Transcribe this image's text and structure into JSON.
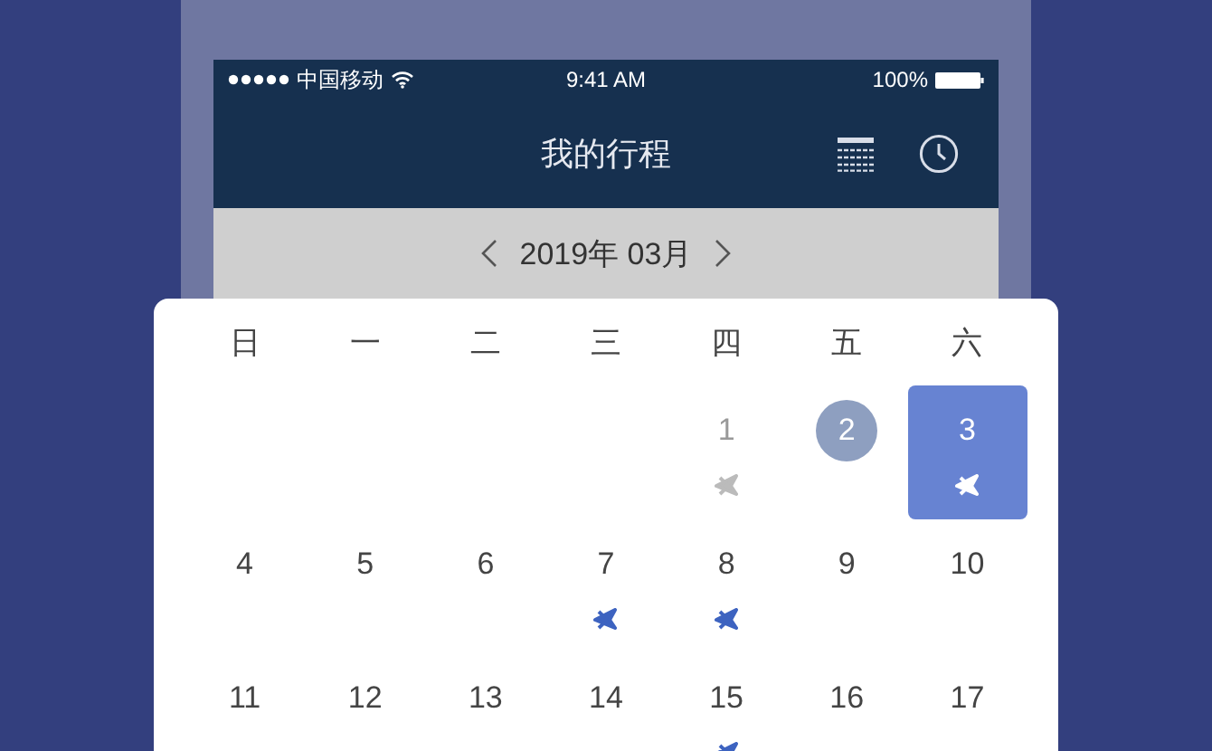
{
  "status_bar": {
    "carrier": "中国移动",
    "time": "9:41 AM",
    "battery": "100%"
  },
  "nav_bar": {
    "title": "我的行程"
  },
  "month_bar": {
    "label": "2019年 03月"
  },
  "weekdays": [
    "日",
    "一",
    "二",
    "三",
    "四",
    "五",
    "六"
  ],
  "weeks": [
    [
      {
        "kind": "blank"
      },
      {
        "kind": "blank"
      },
      {
        "kind": "blank"
      },
      {
        "kind": "blank"
      },
      {
        "kind": "past",
        "day": "1",
        "selected": false,
        "flight": true
      },
      {
        "kind": "today",
        "day": "2",
        "selected": false,
        "flight": false
      },
      {
        "kind": "normal",
        "day": "3",
        "selected": true,
        "flight": true
      }
    ],
    [
      {
        "kind": "normal",
        "day": "4",
        "selected": false,
        "flight": false
      },
      {
        "kind": "normal",
        "day": "5",
        "selected": false,
        "flight": false
      },
      {
        "kind": "normal",
        "day": "6",
        "selected": false,
        "flight": false
      },
      {
        "kind": "normal",
        "day": "7",
        "selected": false,
        "flight": true
      },
      {
        "kind": "normal",
        "day": "8",
        "selected": false,
        "flight": true
      },
      {
        "kind": "normal",
        "day": "9",
        "selected": false,
        "flight": false
      },
      {
        "kind": "normal",
        "day": "10",
        "selected": false,
        "flight": false
      }
    ],
    [
      {
        "kind": "normal",
        "day": "11",
        "selected": false,
        "flight": false
      },
      {
        "kind": "normal",
        "day": "12",
        "selected": false,
        "flight": false
      },
      {
        "kind": "normal",
        "day": "13",
        "selected": false,
        "flight": false
      },
      {
        "kind": "normal",
        "day": "14",
        "selected": false,
        "flight": false
      },
      {
        "kind": "normal",
        "day": "15",
        "selected": false,
        "flight": true
      },
      {
        "kind": "normal",
        "day": "16",
        "selected": false,
        "flight": false
      },
      {
        "kind": "normal",
        "day": "17",
        "selected": false,
        "flight": false
      }
    ]
  ]
}
